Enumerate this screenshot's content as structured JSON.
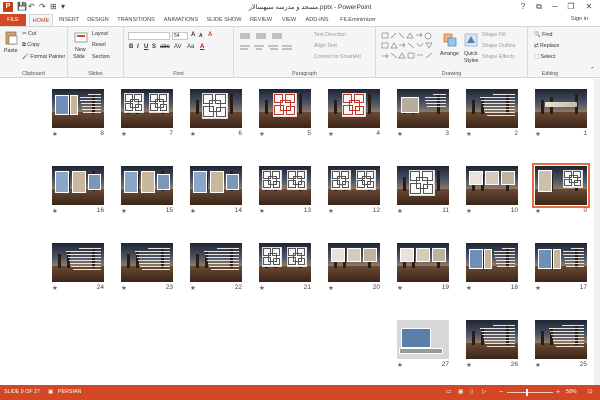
{
  "app": {
    "logo_letter": "P",
    "title": "مسجد و مدرسه سپهسالار.pptx - PowerPoint",
    "quick_access": [
      "💾",
      "↶",
      "↷",
      "⊞",
      "▾"
    ],
    "window_controls": [
      "?",
      "⧉",
      "─",
      "❐",
      "✕"
    ],
    "sign_in": "Sign in"
  },
  "tabs": [
    {
      "label": "FILE",
      "id": "file"
    },
    {
      "label": "HOME",
      "id": "home"
    },
    {
      "label": "INSERT",
      "id": "insert"
    },
    {
      "label": "DESIGN",
      "id": "design"
    },
    {
      "label": "TRANSITIONS",
      "id": "transitions"
    },
    {
      "label": "ANIMATIONS",
      "id": "animations"
    },
    {
      "label": "SLIDE SHOW",
      "id": "slideshow"
    },
    {
      "label": "REVIEW",
      "id": "review"
    },
    {
      "label": "VIEW",
      "id": "view"
    },
    {
      "label": "ADD-INS",
      "id": "addins"
    },
    {
      "label": "FILEminimizer",
      "id": "fileminimizer"
    }
  ],
  "ribbon": {
    "clipboard": {
      "label": "Clipboard",
      "paste": "Paste",
      "cut": "Cut",
      "copy": "Copy",
      "format_painter": "Format Painter"
    },
    "slides": {
      "label": "Slides",
      "new_slide": "New",
      "new_slide_2": "Slide",
      "layout": "Layout",
      "reset": "Reset",
      "section": "Section"
    },
    "font": {
      "label": "Font",
      "font_name": "",
      "font_size": "54",
      "grow": "A",
      "shrink": "A",
      "clear": "A",
      "bold": "B",
      "italic": "I",
      "underline": "U",
      "shadow": "S",
      "strike": "abc",
      "spacing": "AV",
      "case": "Aa",
      "color": "A"
    },
    "paragraph": {
      "label": "Paragraph",
      "text_direction": "Text Direction",
      "align_text": "Align Text",
      "smartart": "Convert to SmartArt"
    },
    "drawing": {
      "label": "Drawing",
      "arrange": "Arrange",
      "quick_styles": "Quick",
      "quick_styles_2": "Styles",
      "shape_fill": "Shape Fill",
      "shape_outline": "Shape Outline",
      "shape_effects": "Shape Effects"
    },
    "editing": {
      "label": "Editing",
      "find": "Find",
      "replace": "Replace",
      "select": "Select"
    }
  },
  "slides": [
    {
      "num": "1",
      "style": "title"
    },
    {
      "num": "2",
      "style": "text"
    },
    {
      "num": "3",
      "style": "text-photo"
    },
    {
      "num": "4",
      "style": "plan-red"
    },
    {
      "num": "5",
      "style": "plan-red"
    },
    {
      "num": "6",
      "style": "plan"
    },
    {
      "num": "7",
      "style": "plans"
    },
    {
      "num": "8",
      "style": "photo-text"
    },
    {
      "num": "9",
      "style": "photo-plan",
      "selected": true
    },
    {
      "num": "10",
      "style": "pics"
    },
    {
      "num": "11",
      "style": "plan"
    },
    {
      "num": "12",
      "style": "plans"
    },
    {
      "num": "13",
      "style": "plans"
    },
    {
      "num": "14",
      "style": "photos"
    },
    {
      "num": "15",
      "style": "photos"
    },
    {
      "num": "16",
      "style": "photos"
    },
    {
      "num": "17",
      "style": "photo-text"
    },
    {
      "num": "18",
      "style": "photo-text"
    },
    {
      "num": "19",
      "style": "pics"
    },
    {
      "num": "20",
      "style": "pics"
    },
    {
      "num": "21",
      "style": "plans"
    },
    {
      "num": "22",
      "style": "text"
    },
    {
      "num": "23",
      "style": "text"
    },
    {
      "num": "24",
      "style": "text"
    },
    {
      "num": "25",
      "style": "text"
    },
    {
      "num": "26",
      "style": "text"
    },
    {
      "num": "27",
      "style": "laptop"
    }
  ],
  "star_glyph": "★",
  "status": {
    "slide_info": "SLIDE 9 OF 27",
    "language": "PERSIAN",
    "zoom": "58%",
    "zoom_out": "−",
    "zoom_in": "+"
  },
  "colors": {
    "accent": "#d24726",
    "selected_outline": "#e46c3f"
  }
}
